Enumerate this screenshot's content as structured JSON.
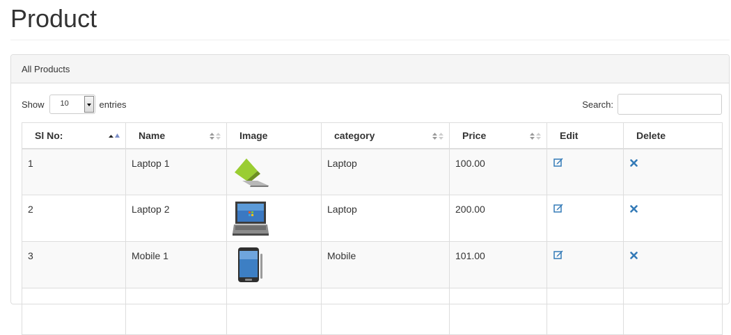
{
  "page": {
    "title": "Product"
  },
  "panel": {
    "heading": "All Products"
  },
  "controls": {
    "show_label": "Show",
    "length_value": "10",
    "entries_label": "entries",
    "search_label": "Search:",
    "search_value": ""
  },
  "table": {
    "columns": [
      "Sl No:",
      "Name",
      "Image",
      "category",
      "Price",
      "Edit",
      "Delete"
    ],
    "rows": [
      {
        "sl": "1",
        "name": "Laptop 1",
        "image": "green-laptop-image",
        "category": "Laptop",
        "price": "100.00"
      },
      {
        "sl": "2",
        "name": "Laptop 2",
        "image": "windows-laptop-image",
        "category": "Laptop",
        "price": "200.00"
      },
      {
        "sl": "3",
        "name": "Mobile 1",
        "image": "smartphone-image",
        "category": "Mobile",
        "price": "101.00"
      }
    ]
  },
  "icons": {
    "edit": "edit-icon",
    "delete": "delete-icon",
    "sort": "sort-icon"
  },
  "colors": {
    "link": "#337ab7",
    "row_odd": "#f9f9f9",
    "border": "#dddddd"
  }
}
